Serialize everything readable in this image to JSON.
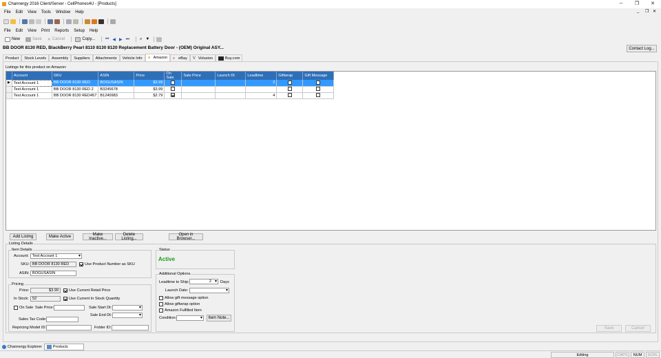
{
  "window": {
    "title": "Channergy 2016 Client/Server - CellPhones4U - [Products]"
  },
  "menu1": [
    "File",
    "Edit",
    "View",
    "Tools",
    "Window",
    "Help"
  ],
  "menu2": [
    "File",
    "Edit",
    "View",
    "Print",
    "Reports",
    "Setup",
    "Help"
  ],
  "toolbar2": {
    "new": "New",
    "save": "Save",
    "cancel": "Cancel",
    "copy": "Copy..."
  },
  "product_title": "BB DOOR 8130 RED, BlackBerry Pearl 8110 8130 8120 Replacement Battery Door - (OEM) Original ASY...",
  "contact_log": "Contact Log...",
  "tabs": [
    "Product",
    "Stock Levels",
    "Assembly",
    "Suppliers",
    "Attachments",
    "Vehicle Info",
    "Amazon",
    "eBay",
    "Volusion",
    "Buy.com"
  ],
  "listings_label": "Listings for this product on Amazon:",
  "grid": {
    "columns": [
      "Account",
      "SKU",
      "ASIN",
      "Price",
      "On Sale",
      "Sale Price",
      "Launch Dt",
      "Leadtime",
      "Giftwrap",
      "Gift Message"
    ],
    "rows": [
      {
        "account": "Test Account 1",
        "sku": "BB DOOR 8130 RED",
        "asin": "BOGUSASIN",
        "price": "$3.99",
        "on_sale": false,
        "sale_price": "",
        "launch": "",
        "leadtime": "2",
        "giftwrap": false,
        "giftmsg": false
      },
      {
        "account": "Test Account 1",
        "sku": "BB DOOR 8130 RED 2",
        "asin": "B3245678",
        "price": "$3.99",
        "on_sale": false,
        "sale_price": "",
        "launch": "",
        "leadtime": "",
        "giftwrap": false,
        "giftmsg": false
      },
      {
        "account": "Test Account 1",
        "sku": "BB DOOR 8130 RED457",
        "asin": "B1240983",
        "price": "$2.79",
        "on_sale": true,
        "sale_price": "",
        "launch": "",
        "leadtime": "4",
        "giftwrap": false,
        "giftmsg": false
      }
    ]
  },
  "actions": {
    "add": "Add Listing",
    "active": "Make Active",
    "inactive": "Make Inactive...",
    "delete": "Delete Listing...",
    "browser": "Open in Browser..."
  },
  "details": {
    "group": "Listing Details",
    "item_details": "Item Details",
    "account_label": "Account:",
    "account_value": "Test Account 1",
    "sku_label": "SKU:",
    "sku_value": "BB DOOR 8130 RED",
    "use_pn_label": "Use Product Number as SKU",
    "asin_label": "ASIN:",
    "asin_value": "BOGUSASIN",
    "pricing": "Pricing",
    "price_label": "Price:",
    "price_value": "$3.99",
    "use_retail": "Use Current Retail Price",
    "instock_label": "In Stock:",
    "instock_value": "52",
    "use_stock": "Use Current In Stock Quantity",
    "onsale_label": "On Sale",
    "saleprice_label": "Sale Price:",
    "sale_start": "Sale Start Dt:",
    "sale_end": "Sale End Dt:",
    "tax_label": "Sales Tax Code:",
    "repricing_label": "Repricing Model ID:",
    "folder_label": "Folder ID:",
    "status_group": "Status",
    "status_value": "Active",
    "additional": "Additional Options",
    "leadtime_label": "Leadtime to Ship:",
    "leadtime_value": "2",
    "days": "Days",
    "launch_label": "Launch Date:",
    "allow_msg": "Allow gift message option",
    "allow_wrap": "Allow giftwrap option",
    "fba": "Amazon Fulfilled Item",
    "condition_label": "Condition:",
    "item_note": "Item Note..."
  },
  "bottom_buttons": {
    "save": "Save",
    "cancel": "Cancel"
  },
  "taskbar": {
    "explorer": "Channergy Explorer",
    "products": "Products"
  },
  "statusbar": {
    "mode": "Editing",
    "caps": "CAPS",
    "num": "NUM",
    "scrl": "SCRL"
  }
}
